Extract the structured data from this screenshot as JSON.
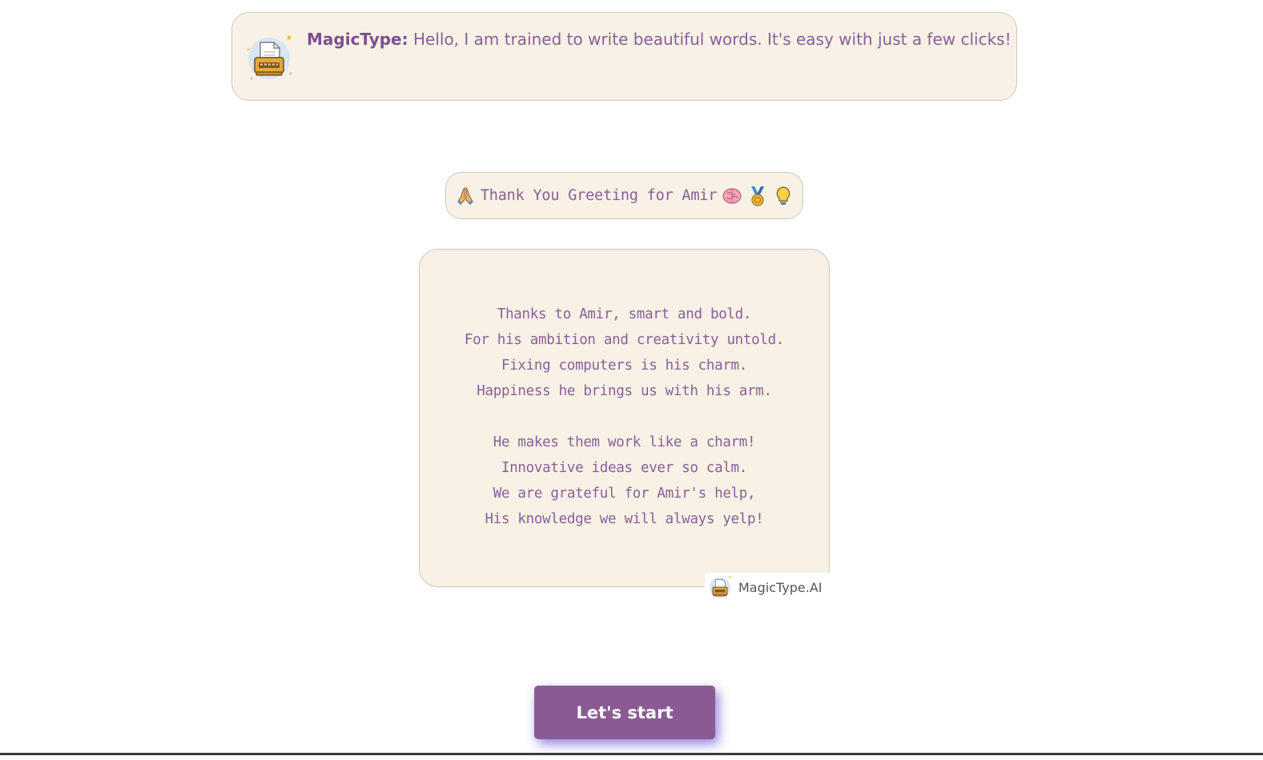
{
  "intro": {
    "speaker": "MagicType:",
    "message": " Hello, I am trained to write beautiful words. It's easy with just a few clicks!"
  },
  "title": {
    "text": "Thank You Greeting for Amir",
    "leading_icon": "praying-hands-icon",
    "trailing_icons": [
      "brain-icon",
      "medal-icon",
      "lightbulb-icon"
    ]
  },
  "poem": {
    "stanzas": [
      [
        "Thanks to Amir, smart and bold.",
        "For his ambition and creativity untold.",
        "Fixing computers is his charm.",
        "Happiness he brings us with his arm."
      ],
      [
        "He makes them work like a charm!",
        "Innovative ideas ever so calm.",
        "We are grateful for Amir's help,",
        "His knowledge we will always yelp!"
      ]
    ]
  },
  "watermark": {
    "brand": "MagicType.AI"
  },
  "cta": {
    "label": "Let's start"
  },
  "colors": {
    "card_bg": "#f7f1e6",
    "text_purple": "#8a5f98",
    "button_bg": "#8b5a94"
  }
}
